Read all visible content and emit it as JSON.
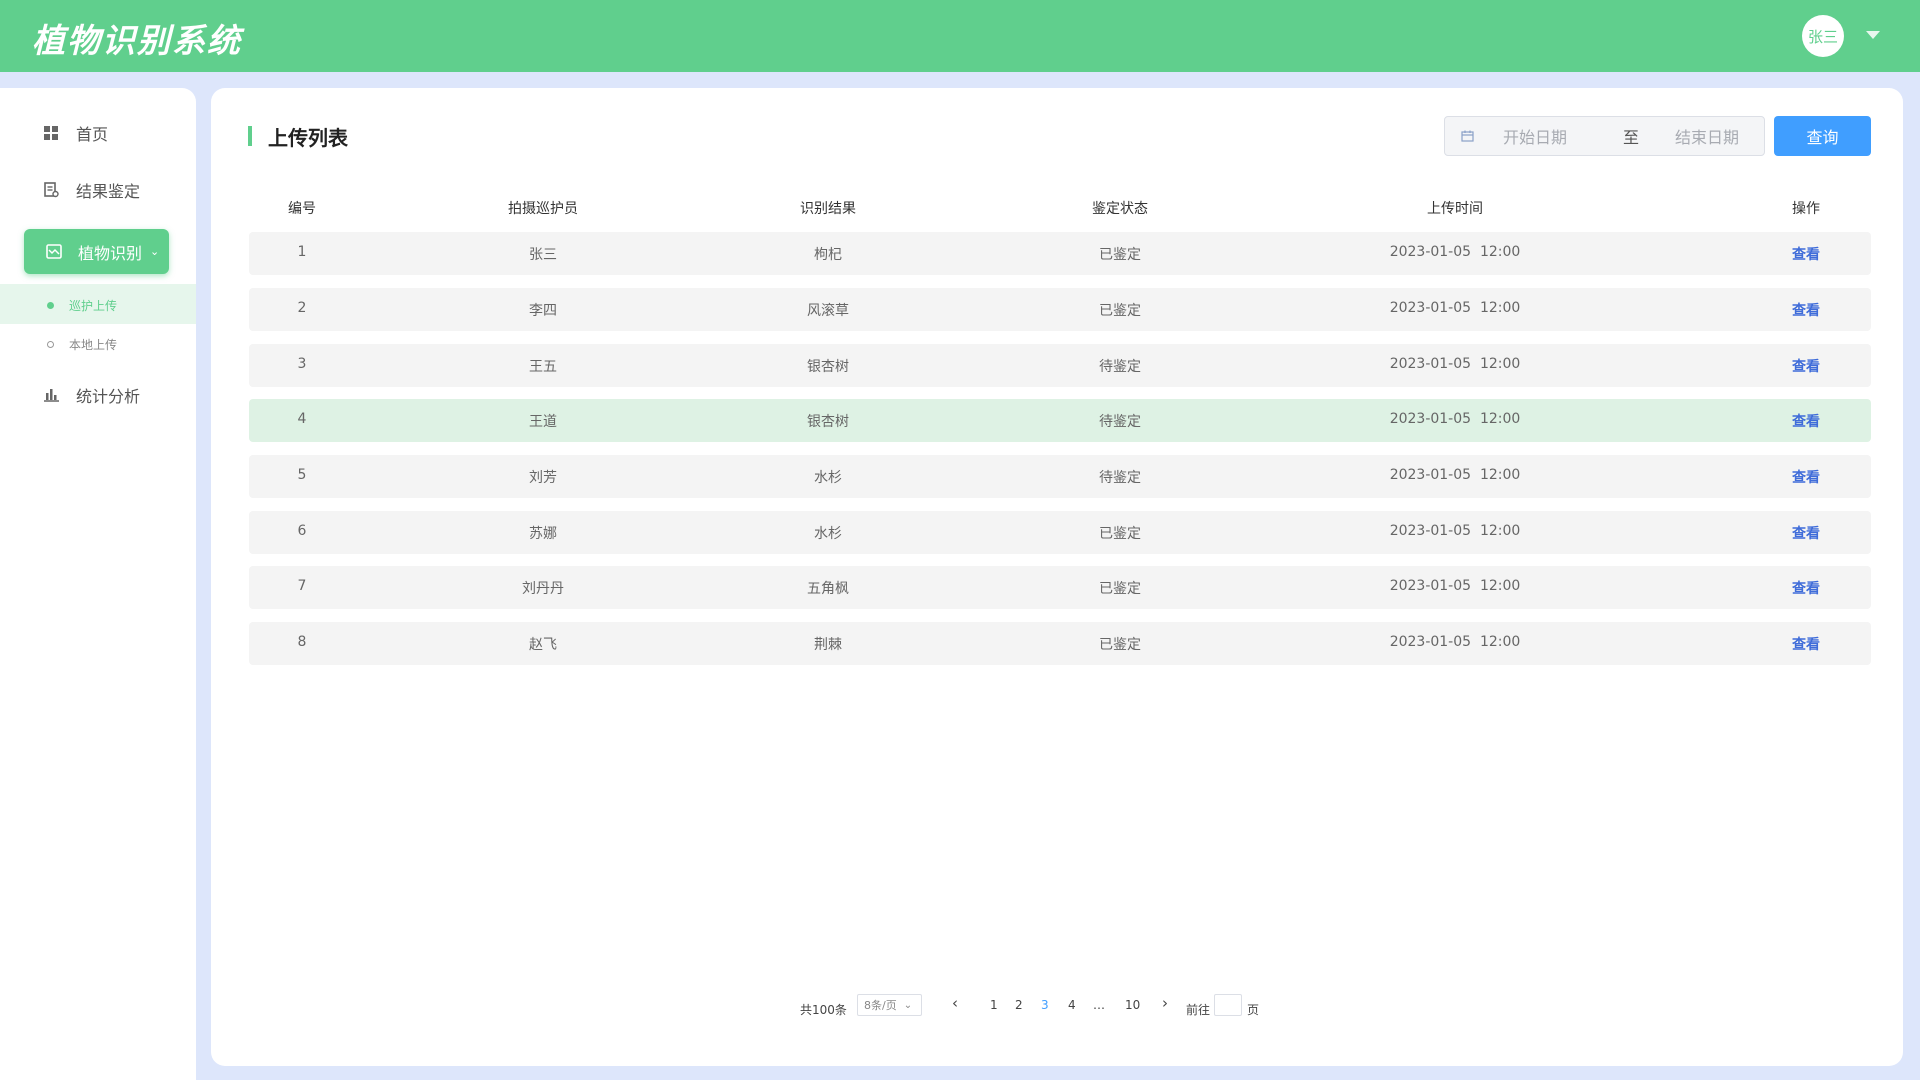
{
  "header": {
    "title": "植物识别系统",
    "user_name": "张三"
  },
  "sidebar": {
    "items": [
      {
        "label": "首页"
      },
      {
        "label": "结果鉴定"
      },
      {
        "label": "植物识别"
      },
      {
        "label": "统计分析"
      }
    ],
    "sub_items": [
      {
        "label": "巡护上传"
      },
      {
        "label": "本地上传"
      }
    ]
  },
  "main": {
    "title": "上传列表",
    "date_start_placeholder": "开始日期",
    "date_separator": "至",
    "date_end_placeholder": "结束日期",
    "query_label": "查询"
  },
  "table": {
    "headers": [
      "编号",
      "拍摄巡护员",
      "识别结果",
      "鉴定状态",
      "上传时间",
      "操作"
    ],
    "rows": [
      {
        "id": "1",
        "ranger": "张三",
        "result": "枸杞",
        "status": "已鉴定",
        "time": "2023-01-05  12:00",
        "action": "查看"
      },
      {
        "id": "2",
        "ranger": "李四",
        "result": "风滚草",
        "status": "已鉴定",
        "time": "2023-01-05  12:00",
        "action": "查看"
      },
      {
        "id": "3",
        "ranger": "王五",
        "result": "银杏树",
        "status": "待鉴定",
        "time": "2023-01-05  12:00",
        "action": "查看"
      },
      {
        "id": "4",
        "ranger": "王道",
        "result": "银杏树",
        "status": "待鉴定",
        "time": "2023-01-05  12:00",
        "action": "查看"
      },
      {
        "id": "5",
        "ranger": "刘芳",
        "result": "水杉",
        "status": "待鉴定",
        "time": "2023-01-05  12:00",
        "action": "查看"
      },
      {
        "id": "6",
        "ranger": "苏娜",
        "result": "水杉",
        "status": "已鉴定",
        "time": "2023-01-05  12:00",
        "action": "查看"
      },
      {
        "id": "7",
        "ranger": "刘丹丹",
        "result": "五角枫",
        "status": "已鉴定",
        "time": "2023-01-05  12:00",
        "action": "查看"
      },
      {
        "id": "8",
        "ranger": "赵飞",
        "result": "荆棘",
        "status": "已鉴定",
        "time": "2023-01-05  12:00",
        "action": "查看"
      }
    ]
  },
  "pagination": {
    "total": "共100条",
    "page_size": "8条/页",
    "pages": [
      "1",
      "2",
      "3",
      "4",
      "…",
      "10"
    ],
    "current_page": "3",
    "goto_prefix": "前往",
    "goto_suffix": "页"
  },
  "colors": {
    "brand": "#60cf8d",
    "link": "#3f6cd9",
    "button": "#409eff"
  }
}
